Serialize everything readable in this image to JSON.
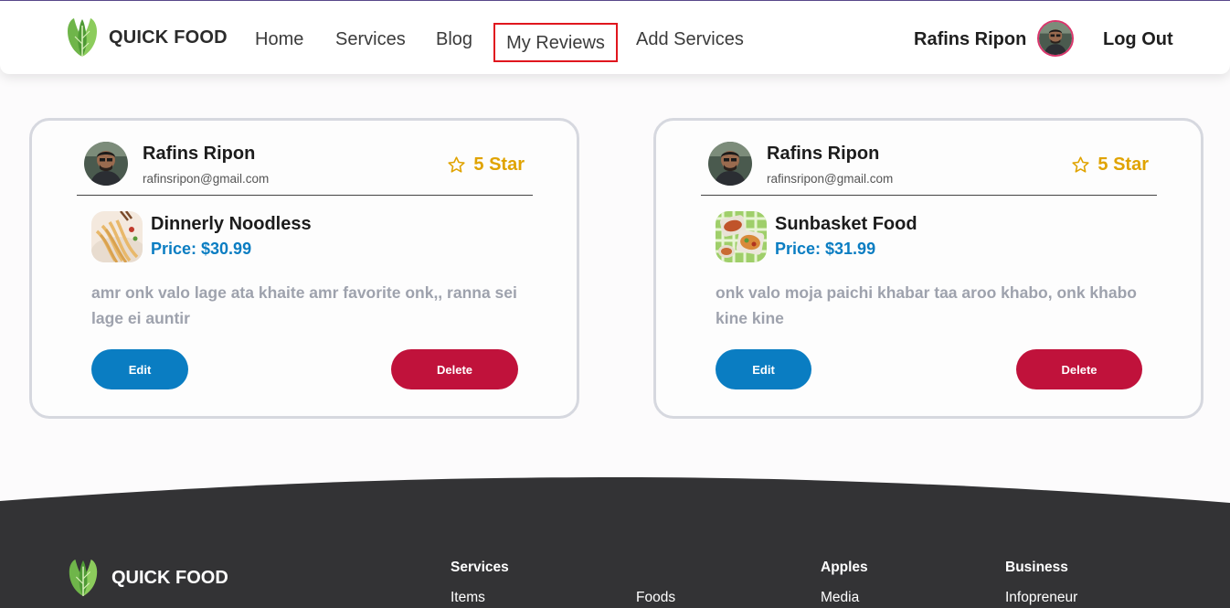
{
  "nav": {
    "brand": "QUICK FOOD",
    "links": [
      "Home",
      "Services",
      "Blog",
      "My Reviews",
      "Add Services"
    ],
    "user_name": "Rafins Ripon",
    "logout": "Log Out"
  },
  "reviews": [
    {
      "reviewer": "Rafins Ripon",
      "email": "rafinsripon@gmail.com",
      "rating": "5 Star",
      "service": "Dinnerly Noodless",
      "price": "Price: $30.99",
      "text": "amr onk valo lage ata khaite amr favorite onk,, ranna sei lage ei auntir",
      "edit": "Edit",
      "delete": "Delete"
    },
    {
      "reviewer": "Rafins Ripon",
      "email": "rafinsripon@gmail.com",
      "rating": "5 Star",
      "service": "Sunbasket Food",
      "price": "Price: $31.99",
      "text": "onk valo moja paichi khabar taa aroo khabo, onk khabo kine kine",
      "edit": "Edit",
      "delete": "Delete"
    }
  ],
  "footer": {
    "brand": "QUICK FOOD",
    "columns": [
      {
        "title": "Services",
        "links": [
          "Items"
        ]
      },
      {
        "title": "",
        "links": [
          "Foods"
        ]
      },
      {
        "title": "Apples",
        "links": [
          "Media"
        ]
      },
      {
        "title": "Business",
        "links": [
          "Infopreneur"
        ]
      }
    ]
  },
  "colors": {
    "accent_blue": "#0a7dc2",
    "delete_red": "#c0123b",
    "star_gold": "#e0a300",
    "footer_bg": "#333335",
    "active_outline": "#e0161e"
  },
  "icons": [
    "leaf-logo-icon",
    "star-outline-icon",
    "user-avatar",
    "noodles-thumbnail",
    "food-box-thumbnail"
  ]
}
